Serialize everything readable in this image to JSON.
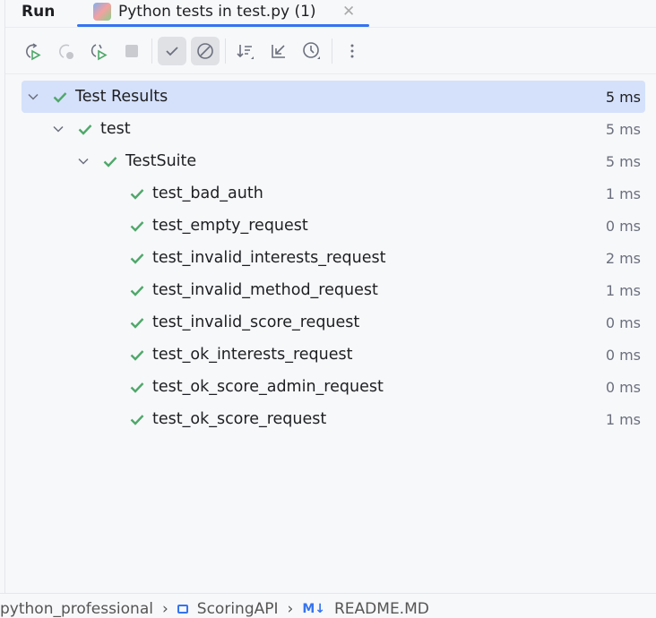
{
  "tabs": [
    {
      "label": "Run"
    },
    {
      "label": "Python tests in test.py (1)",
      "active": true
    }
  ],
  "toolbar": {
    "buttons": [
      "rerun",
      "rerun-failed",
      "rerun-automatically",
      "stop",
      "show-passed",
      "show-ignored",
      "sort",
      "collapse",
      "history",
      "more"
    ]
  },
  "colors": {
    "accent": "#3574f0",
    "pass": "#4fa86a",
    "selected": "#d5e1fb"
  },
  "tree": [
    {
      "label": "Test Results",
      "time": "5 ms",
      "level": 0,
      "expanded": true
    },
    {
      "label": "test",
      "time": "5 ms",
      "level": 1,
      "expanded": true
    },
    {
      "label": "TestSuite",
      "time": "5 ms",
      "level": 2,
      "expanded": true
    },
    {
      "label": "test_bad_auth",
      "time": "1 ms",
      "level": 3
    },
    {
      "label": "test_empty_request",
      "time": "0 ms",
      "level": 3
    },
    {
      "label": "test_invalid_interests_request",
      "time": "2 ms",
      "level": 3
    },
    {
      "label": "test_invalid_method_request",
      "time": "1 ms",
      "level": 3
    },
    {
      "label": "test_invalid_score_request",
      "time": "0 ms",
      "level": 3
    },
    {
      "label": "test_ok_interests_request",
      "time": "0 ms",
      "level": 3
    },
    {
      "label": "test_ok_score_admin_request",
      "time": "0 ms",
      "level": 3
    },
    {
      "label": "test_ok_score_request",
      "time": "1 ms",
      "level": 3
    }
  ],
  "breadcrumb": [
    "python_professional",
    "ScoringAPI",
    "README.MD"
  ],
  "breadcrumb_md_badge": "M↓"
}
